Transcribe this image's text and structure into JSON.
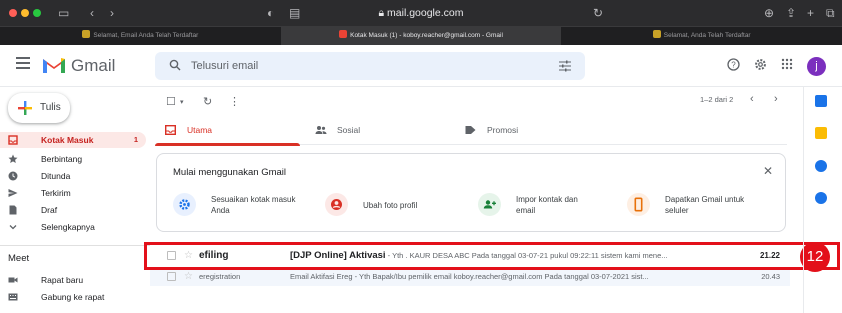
{
  "browser": {
    "url": "mail.google.com",
    "tabs": [
      {
        "label": "Selamat, Email Anda Telah Terdaftar",
        "active": false
      },
      {
        "label": "Kotak Masuk (1) - koboy.reacher@gmail.com - Gmail",
        "active": true
      },
      {
        "label": "Selamat, Anda Telah Terdaftar",
        "active": false
      }
    ]
  },
  "header": {
    "app_name": "Gmail",
    "search_placeholder": "Telusuri email",
    "avatar_initial": "j"
  },
  "sidebar": {
    "compose_label": "Tulis",
    "items": [
      {
        "label": "Kotak Masuk",
        "count": "1",
        "icon": "inbox-icon",
        "active": true
      },
      {
        "label": "Berbintang",
        "count": "",
        "icon": "star-icon",
        "active": false
      },
      {
        "label": "Ditunda",
        "count": "",
        "icon": "clock-icon",
        "active": false
      },
      {
        "label": "Terkirim",
        "count": "",
        "icon": "send-icon",
        "active": false
      },
      {
        "label": "Draf",
        "count": "",
        "icon": "draft-icon",
        "active": false
      },
      {
        "label": "Selengkapnya",
        "count": "",
        "icon": "chevron-down-icon",
        "active": false
      }
    ],
    "meet": {
      "title": "Meet",
      "items": [
        {
          "label": "Rapat baru",
          "icon": "video-icon"
        },
        {
          "label": "Gabung ke rapat",
          "icon": "keyboard-icon"
        }
      ]
    }
  },
  "main": {
    "pager": "1–2 dari 2",
    "tabs": [
      {
        "label": "Utama",
        "icon": "inbox-icon",
        "active": true
      },
      {
        "label": "Sosial",
        "icon": "people-icon",
        "active": false
      },
      {
        "label": "Promosi",
        "icon": "tag-icon",
        "active": false
      }
    ],
    "setup_card": {
      "title": "Mulai menggunakan Gmail",
      "steps": [
        {
          "label": "Sesuaikan kotak masuk Anda",
          "icon": "gear-icon",
          "color": "#1a73e8",
          "bg": "#e8f0fe"
        },
        {
          "label": "Ubah foto profil",
          "icon": "account-icon",
          "color": "#d93025",
          "bg": "#fce8e6"
        },
        {
          "label": "Impor kontak dan email",
          "icon": "add-person-icon",
          "color": "#188038",
          "bg": "#e6f4ea"
        },
        {
          "label": "Dapatkan Gmail untuk seluler",
          "icon": "phone-icon",
          "color": "#e8710a",
          "bg": "#feefe3"
        }
      ]
    },
    "emails": [
      {
        "sender": "efiling",
        "subject": "[DJP Online] Aktivasi",
        "snippet": " - Yth . KAUR DESA ABC      Pada tanggal 03-07-21 pukul 09:22:11 sistem kami mene...",
        "date": "21.22",
        "unread": true
      },
      {
        "sender": "eregistration",
        "subject": "Email Aktifasi Ereg",
        "snippet": " - Yth Bapak/Ibu pemilik email koboy.reacher@gmail.com Pada tanggal 03-07-2021 sist...",
        "date": "20.43",
        "unread": false
      }
    ]
  },
  "annotation": {
    "step_number": "12",
    "color": "#e3101a"
  }
}
